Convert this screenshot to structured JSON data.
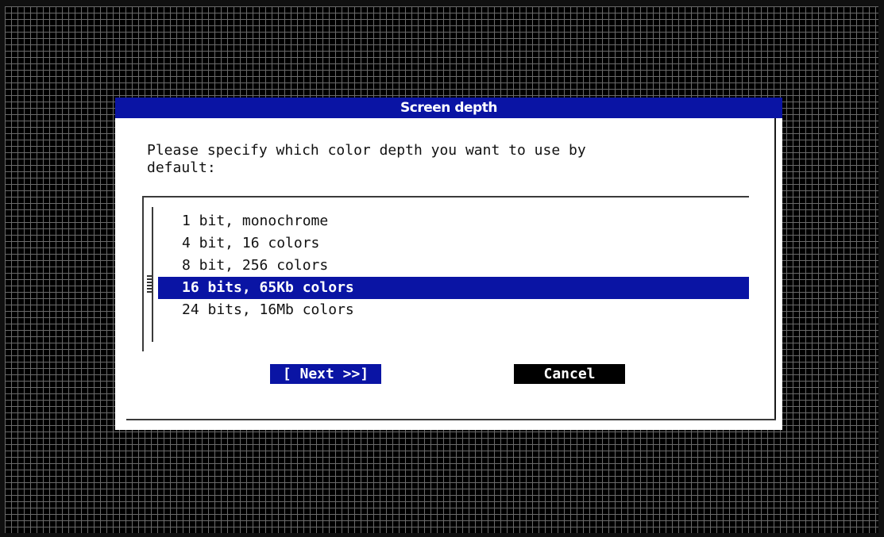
{
  "dialog": {
    "title": "Screen depth",
    "prompt": "Please specify which color depth you want to use by\ndefault:",
    "options": [
      {
        "label": "1 bit, monochrome",
        "selected": false
      },
      {
        "label": "4 bit, 16 colors",
        "selected": false
      },
      {
        "label": "8 bit, 256 colors",
        "selected": false
      },
      {
        "label": "16 bits, 65Kb colors",
        "selected": true
      },
      {
        "label": "24 bits, 16Mb colors",
        "selected": false
      }
    ],
    "buttons": {
      "next_label": "[ Next >>]",
      "cancel_label": "Cancel"
    }
  },
  "colors": {
    "accent": "#0a14a4",
    "background": "#000000",
    "grid": "#6a6a6a",
    "dialog": "#ffffff"
  }
}
